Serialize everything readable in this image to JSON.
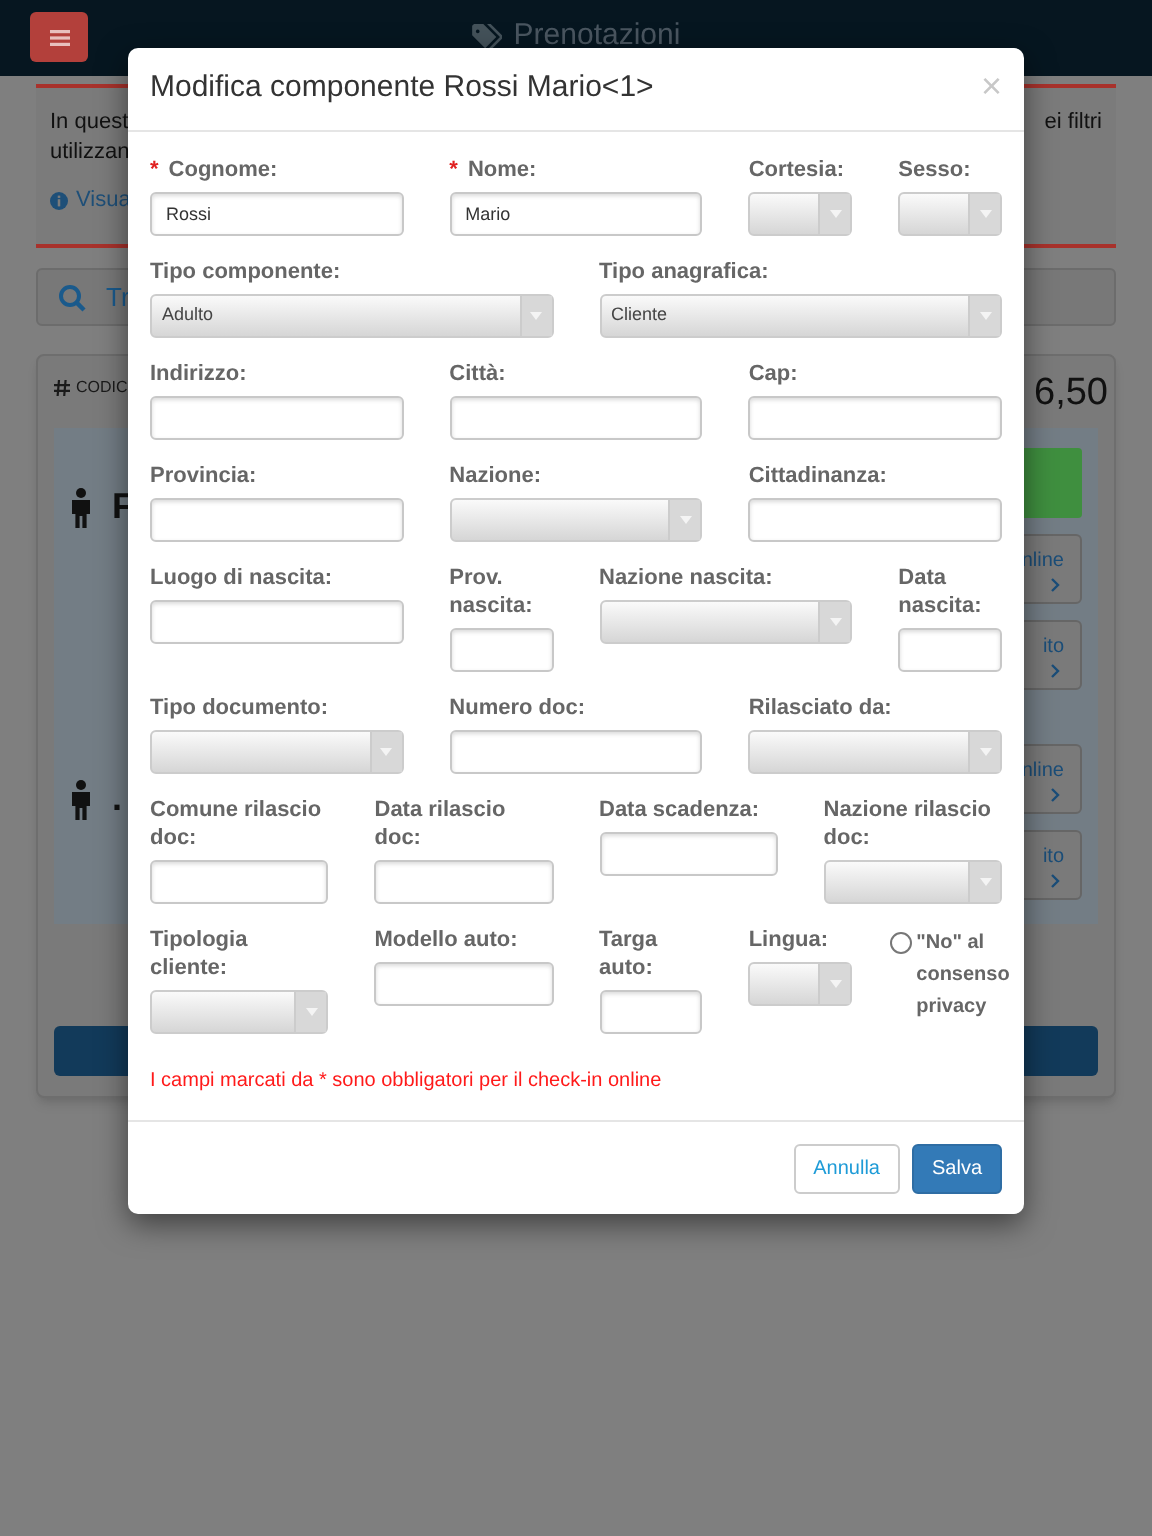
{
  "header": {
    "title": "Prenotazioni"
  },
  "background": {
    "info_left": [
      "In quest",
      "utilizzan"
    ],
    "info_link": "Visua",
    "info_right": "ei filtri",
    "search_text": "Tr",
    "code_label": "CODIC",
    "amount": "6,50",
    "guests": [
      {
        "name": "F",
        "highlight": true,
        "buttons": [
          "nline",
          "ito"
        ]
      },
      {
        "name": ".",
        "highlight": false,
        "buttons": [
          "nline",
          "ito"
        ]
      }
    ]
  },
  "modal": {
    "title": "Modifica componente Rossi Mario<1>",
    "close": "×",
    "required_mark": "*",
    "fields": [
      {
        "kind": "text",
        "label": "Cognome:",
        "value": "Rossi",
        "required": true
      },
      {
        "kind": "text",
        "label": "Nome:",
        "value": "Mario",
        "required": true
      },
      {
        "kind": "select",
        "label": "Cortesia:",
        "required": false
      },
      {
        "kind": "select",
        "label": "Sesso:",
        "required": false
      },
      {
        "kind": "select",
        "label": "Tipo componente:",
        "value": "Adulto",
        "required": false
      },
      {
        "kind": "select",
        "label": "Tipo anagrafica:",
        "value": "Cliente",
        "required": false
      },
      {
        "kind": "text",
        "label": "Indirizzo:",
        "required": false
      },
      {
        "kind": "text",
        "label": "Città:",
        "required": false
      },
      {
        "kind": "text",
        "label": "Cap:",
        "required": false
      },
      {
        "kind": "text",
        "label": "Provincia:",
        "required": false
      },
      {
        "kind": "select",
        "label": "Nazione:",
        "required": false
      },
      {
        "kind": "text",
        "label": "Cittadinanza:",
        "required": false
      },
      {
        "kind": "text",
        "label": "Luogo di nascita:",
        "required": false
      },
      {
        "kind": "text",
        "label": "Prov. nascita:",
        "required": false
      },
      {
        "kind": "select",
        "label": "Nazione nascita:",
        "required": false
      },
      {
        "kind": "text",
        "label": "Data nascita:",
        "required": false
      },
      {
        "kind": "select",
        "label": "Tipo documento:",
        "required": false
      },
      {
        "kind": "text",
        "label": "Numero doc:",
        "required": false
      },
      {
        "kind": "select",
        "label": "Rilasciato da:",
        "required": false
      },
      {
        "kind": "text",
        "label": "Comune rilascio doc:",
        "required": false
      },
      {
        "kind": "text",
        "label": "Data rilascio doc:",
        "required": false
      },
      {
        "kind": "text",
        "label": "Data scadenza:",
        "required": false
      },
      {
        "kind": "select",
        "label": "Nazione rilascio doc:",
        "required": false
      },
      {
        "kind": "select",
        "label": "Tipologia cliente:",
        "required": false
      },
      {
        "kind": "text",
        "label": "Modello auto:",
        "required": false
      },
      {
        "kind": "text",
        "label": "Targa auto:",
        "required": false
      },
      {
        "kind": "select",
        "label": "Lingua:",
        "required": false
      },
      {
        "kind": "checkbox",
        "label": "\"No\" al consenso privacy",
        "checked": false
      }
    ],
    "note": "I campi marcati da * sono obbligatori per il check-in online",
    "buttons": [
      {
        "label": "Annulla",
        "kind": "secondary"
      },
      {
        "label": "Salva",
        "kind": "primary"
      }
    ]
  }
}
